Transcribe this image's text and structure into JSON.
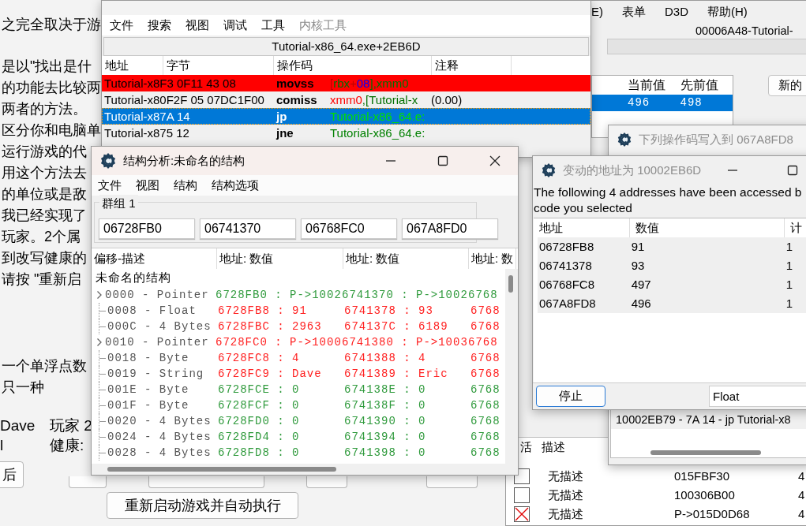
{
  "tutorial": {
    "paragraphs": [
      [
        "之完全取决于游"
      ],
      [
        "是以\"找出是什",
        "的功能去比较两",
        "两者的方法。",
        "区分你和电脑单",
        "运行游戏的代",
        "用这个方法去",
        "的单位或是敌",
        "我已经实现了",
        "玩家。2个属",
        "到改写健康的",
        "请按 \"重新启"
      ],
      [
        "一个单浮点数",
        "只一种"
      ]
    ],
    "player_name": "Dave",
    "player2_label": "玩家 2",
    "player_health": "l",
    "health_label": "健康:",
    "buttons": [
      {
        "label": "后"
      },
      {
        "label": "重新启动游戏并自动执行"
      }
    ]
  },
  "memory_viewer": {
    "menu": [
      {
        "label": "文件",
        "disabled": false
      },
      {
        "label": "搜索",
        "disabled": false
      },
      {
        "label": "视图",
        "disabled": false
      },
      {
        "label": "调试",
        "disabled": false
      },
      {
        "label": "工具",
        "disabled": false
      },
      {
        "label": "内核工具",
        "disabled": true
      }
    ],
    "address": "Tutorial-x86_64.exe+2EB6D",
    "columns": [
      "地址",
      "字节",
      "操作码",
      "注释"
    ],
    "rows": [
      {
        "address_bytes": "Tutorial-x8F3 0F11 43 08",
        "opcode": "movss",
        "breakpoint": true,
        "selected": false,
        "operands": [
          {
            "text": "[",
            "color": "#c00000"
          },
          {
            "text": "rbx",
            "color": "#007000"
          },
          {
            "text": "+",
            "color": "#c00000"
          },
          {
            "text": "08",
            "color": "#0000ff"
          },
          {
            "text": "],xmm0",
            "color": "#007000"
          }
        ]
      },
      {
        "address_bytes": "Tutorial-x80F2F 05 07DC1F00",
        "opcode": "comiss",
        "breakpoint": false,
        "selected": false,
        "operands": [
          {
            "text": "xmm0",
            "color": "#ff0000"
          },
          {
            "text": ",[Tutorial-x",
            "color": "#007000"
          }
        ],
        "comment": "(0.00)"
      },
      {
        "address_bytes": "Tutorial-x87A 14",
        "opcode": "jp",
        "breakpoint": false,
        "selected": true,
        "operands": [
          {
            "text": "Tutorial-x86_64.e:",
            "color": "#00e000"
          }
        ]
      },
      {
        "address_bytes": "Tutorial-x875 12",
        "opcode": "jne",
        "breakpoint": false,
        "selected": false,
        "operands": [
          {
            "text": "Tutorial-x86_64.e:",
            "color": "#008000"
          }
        ]
      }
    ]
  },
  "main_window": {
    "menu": [
      "E)",
      "表单",
      "D3D",
      "帮助(H)"
    ],
    "process_title": "00006A48-Tutorial-",
    "progress": {
      "level": 0
    },
    "scan_columns": [
      "当前值",
      "先前值"
    ],
    "scan_rows": [
      {
        "current": "496",
        "previous": "498",
        "selected": true
      }
    ],
    "new_scan_button": "新的",
    "address_list": {
      "columns": [
        "活",
        "描述"
      ],
      "rows": [
        {
          "checked": false,
          "description": "无描述",
          "address": "015FBF30",
          "type": "4"
        },
        {
          "checked": false,
          "description": "无描述",
          "address": "100306B00",
          "type": "4"
        },
        {
          "checked": true,
          "description": "无描述",
          "address": "P->015D0D68",
          "type": "4"
        }
      ]
    }
  },
  "opcode_window": {
    "title": "下列操作码写入到 067A8FD8",
    "line": "10002EB79 - 7A 14 - jp Tutorial-x8"
  },
  "access_dialog": {
    "title": "变动的地址为 10002EB6D",
    "message": [
      "The following 4 addresses have been accessed b",
      "code you selected"
    ],
    "columns": [
      "地址",
      "数值",
      "计"
    ],
    "rows": [
      {
        "address": "06728FB8",
        "value": "91",
        "count": "1"
      },
      {
        "address": "06741378",
        "value": "93",
        "count": "1"
      },
      {
        "address": "06768FC8",
        "value": "497",
        "count": "1"
      },
      {
        "address": "067A8FD8",
        "value": "496",
        "count": "1"
      }
    ],
    "stop_button": "停止",
    "type_select": "Float"
  },
  "struct_window": {
    "title": "结构分析:未命名的结构",
    "menu": [
      "文件",
      "视图",
      "结构",
      "结构选项"
    ],
    "group_label": "群组 1",
    "addresses": [
      "06728FB0",
      "06741370",
      "06768FC0",
      "067A8FD0"
    ],
    "columns": [
      "偏移-描述",
      "地址: 数值",
      "地址: 数值",
      "地址: 数"
    ],
    "root": "未命名的结构",
    "rows": [
      {
        "offset_desc": "0000 - Pointer",
        "expandable": true,
        "changed": false,
        "values": [
          "6728FB0 : P->1002",
          "6741370 : P->1002",
          "6768"
        ]
      },
      {
        "offset_desc": "0008 - Float",
        "expandable": false,
        "changed": true,
        "values": [
          "6728FB8 : 91",
          "6741378 : 93",
          "6768"
        ]
      },
      {
        "offset_desc": "000C - 4 Bytes",
        "expandable": false,
        "changed": true,
        "values": [
          "6728FBC : 2963",
          "674137C : 6189",
          "6768"
        ]
      },
      {
        "offset_desc": "0010 - Pointer",
        "expandable": true,
        "changed": true,
        "values": [
          "6728FC0 : P->1000",
          "6741380 : P->1003",
          "6768"
        ]
      },
      {
        "offset_desc": "0018 - Byte",
        "expandable": false,
        "changed": true,
        "values": [
          "6728FC8 : 4",
          "6741388 : 4",
          "6768"
        ]
      },
      {
        "offset_desc": "0019 - String",
        "expandable": false,
        "changed": true,
        "values": [
          "6728FC9 : Dave",
          "6741389 : Eric",
          "6768"
        ]
      },
      {
        "offset_desc": "001E - Byte",
        "expandable": false,
        "changed": false,
        "values": [
          "6728FCE : 0",
          "674138E : 0",
          "6768"
        ]
      },
      {
        "offset_desc": "001F - Byte",
        "expandable": false,
        "changed": false,
        "values": [
          "6728FCF : 0",
          "674138F : 0",
          "6768"
        ]
      },
      {
        "offset_desc": "0020 - 4 Bytes",
        "expandable": false,
        "changed": false,
        "values": [
          "6728FD0 : 0",
          "6741390 : 0",
          "6768"
        ]
      },
      {
        "offset_desc": "0024 - 4 Bytes",
        "expandable": false,
        "changed": false,
        "values": [
          "6728FD4 : 0",
          "6741394 : 0",
          "6768"
        ]
      },
      {
        "offset_desc": "0028 - 4 Bytes",
        "expandable": false,
        "changed": false,
        "values": [
          "6728FD8 : 0",
          "6741398 : 0",
          "6768"
        ]
      }
    ]
  }
}
